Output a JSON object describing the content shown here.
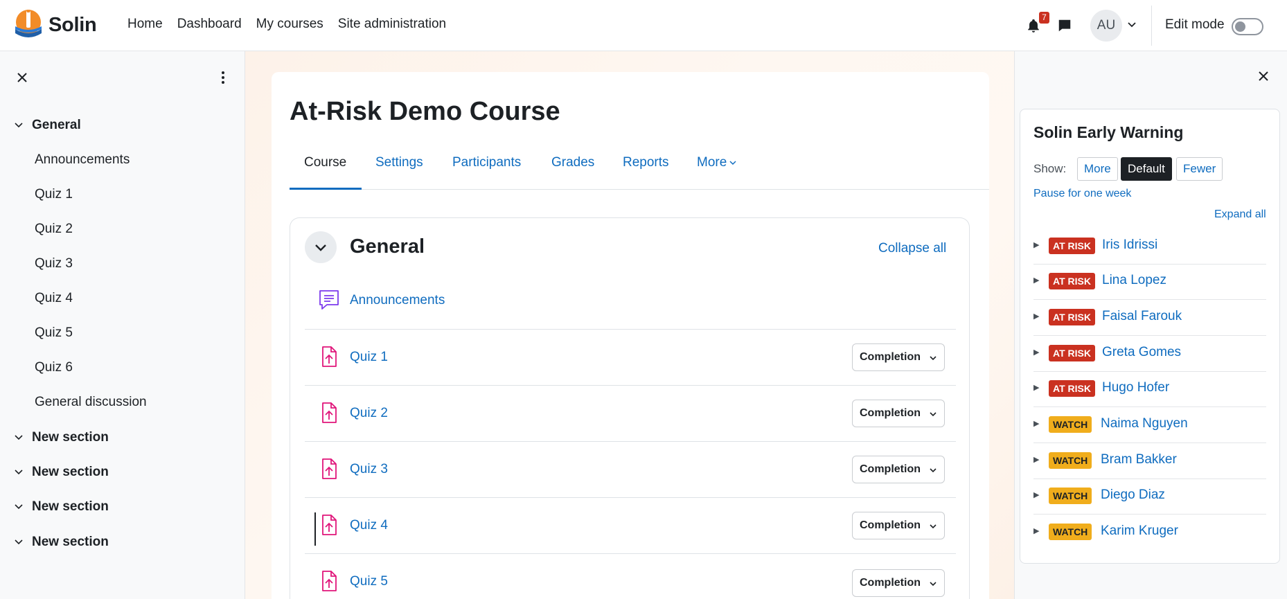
{
  "brand": {
    "name": "Solin"
  },
  "nav": {
    "items": [
      "Home",
      "Dashboard",
      "My courses",
      "Site administration"
    ]
  },
  "header": {
    "notification_count": "7",
    "user_initials": "AU",
    "edit_mode_label": "Edit mode",
    "edit_mode_on": false
  },
  "course_index": {
    "sections": [
      {
        "title": "General",
        "items": [
          "Announcements",
          "Quiz 1",
          "Quiz 2",
          "Quiz 3",
          "Quiz 4",
          "Quiz 5",
          "Quiz 6",
          "General discussion"
        ]
      },
      {
        "title": "New section",
        "items": []
      },
      {
        "title": "New section",
        "items": []
      },
      {
        "title": "New section",
        "items": []
      },
      {
        "title": "New section",
        "items": []
      }
    ]
  },
  "course": {
    "title": "At-Risk Demo Course",
    "tabs": [
      "Course",
      "Settings",
      "Participants",
      "Grades",
      "Reports",
      "More"
    ],
    "active_tab": "Course",
    "section": {
      "title": "General",
      "collapse_all": "Collapse all",
      "activities": [
        {
          "name": "Announcements",
          "type": "forum",
          "completion": ""
        },
        {
          "name": "Quiz 1",
          "type": "assignment",
          "completion": "Completion"
        },
        {
          "name": "Quiz 2",
          "type": "assignment",
          "completion": "Completion"
        },
        {
          "name": "Quiz 3",
          "type": "assignment",
          "completion": "Completion"
        },
        {
          "name": "Quiz 4",
          "type": "assignment",
          "completion": "Completion"
        },
        {
          "name": "Quiz 5",
          "type": "assignment",
          "completion": "Completion"
        }
      ]
    }
  },
  "early_warning": {
    "title": "Solin Early Warning",
    "show_label": "Show:",
    "show_options": [
      "More",
      "Default",
      "Fewer"
    ],
    "show_selected": "Default",
    "pause_link": "Pause for one week",
    "expand_all": "Expand all",
    "students": [
      {
        "status": "AT RISK",
        "name": "Iris Idrissi"
      },
      {
        "status": "AT RISK",
        "name": "Lina Lopez"
      },
      {
        "status": "AT RISK",
        "name": "Faisal Farouk"
      },
      {
        "status": "AT RISK",
        "name": "Greta Gomes"
      },
      {
        "status": "AT RISK",
        "name": "Hugo Hofer"
      },
      {
        "status": "WATCH",
        "name": "Naima Nguyen"
      },
      {
        "status": "WATCH",
        "name": "Bram Bakker"
      },
      {
        "status": "WATCH",
        "name": "Diego Diaz"
      },
      {
        "status": "WATCH",
        "name": "Karim Kruger"
      }
    ]
  },
  "colors": {
    "link": "#0f6cbf",
    "at_risk": "#ca3120",
    "watch": "#f0ad1c",
    "forum_icon": "#7c3aed",
    "assign_icon": "#e0157a"
  }
}
